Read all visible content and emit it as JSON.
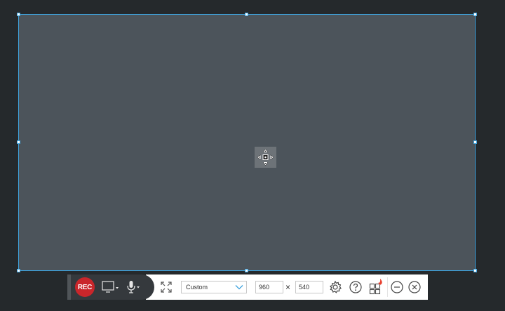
{
  "toolbar": {
    "rec_label": "REC",
    "aspect_select": {
      "value": "Custom"
    },
    "width_value": "960",
    "height_value": "540",
    "times_symbol": "×"
  },
  "colors": {
    "selection_border": "#3ea3de",
    "capture_fill": "#4c545b",
    "rec_red": "#c9262b",
    "toolbar_dark": "#35393d"
  },
  "icons": [
    "move-icon",
    "screen-icon",
    "microphone-icon",
    "fullscreen-icon",
    "chevron-down-icon",
    "gear-icon",
    "help-icon",
    "apps-icon",
    "minimize-icon",
    "close-icon"
  ]
}
